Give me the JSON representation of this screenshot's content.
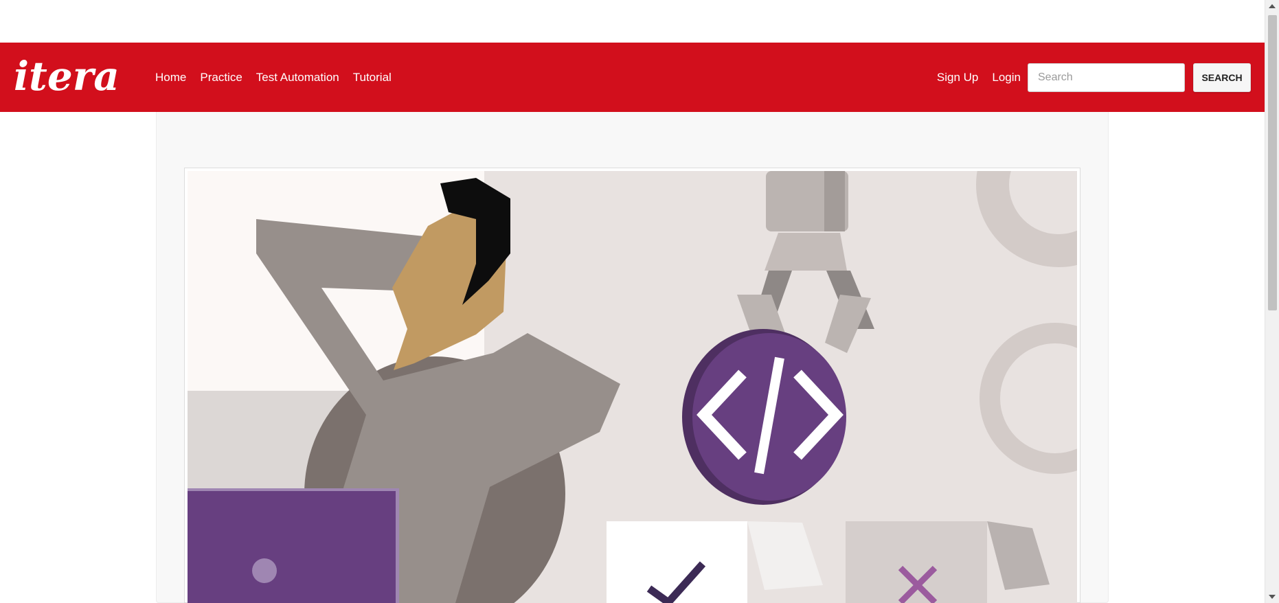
{
  "brand": {
    "logo_text": "itera"
  },
  "nav": {
    "left": [
      {
        "label": "Home"
      },
      {
        "label": "Practice"
      },
      {
        "label": "Test Automation"
      },
      {
        "label": "Tutorial"
      }
    ],
    "right": [
      {
        "label": "Sign Up"
      },
      {
        "label": "Login"
      }
    ],
    "search": {
      "placeholder": "Search",
      "value": "",
      "button_label": "SEARCH"
    }
  },
  "colors": {
    "navbar": "#d20f1c",
    "accent_purple": "#673f80"
  },
  "hero": {
    "illustration": "person-relaxing-with-robot-arm-code-icon"
  }
}
